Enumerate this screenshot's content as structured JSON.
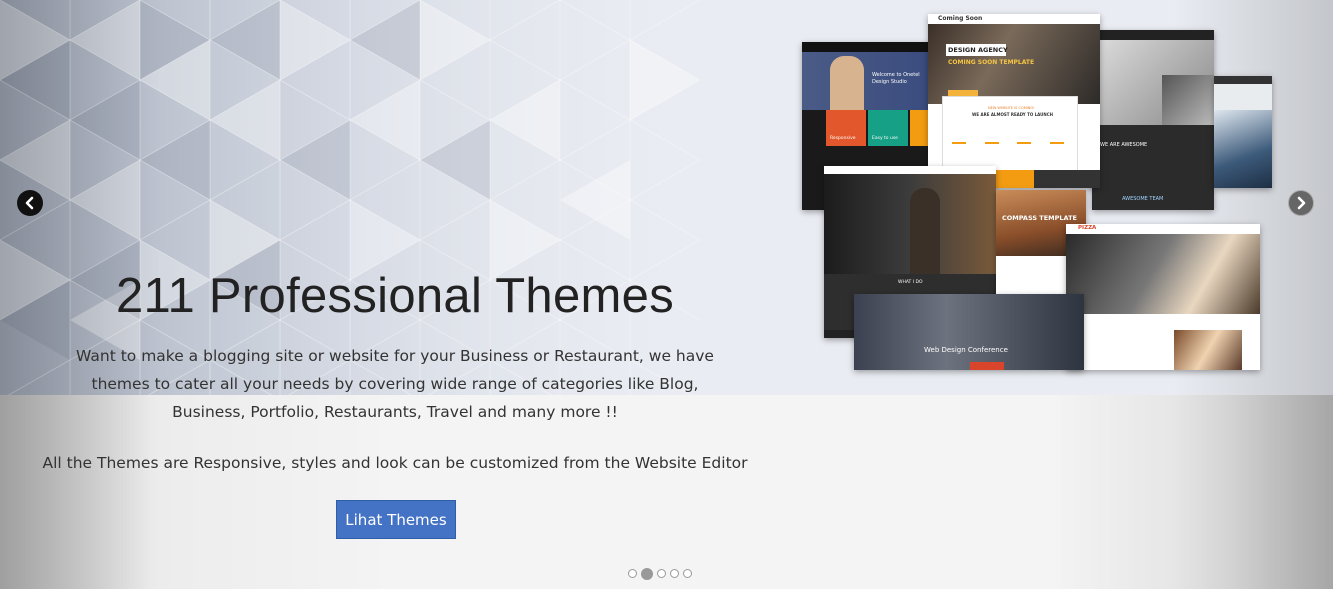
{
  "slide": {
    "title": "211 Professional Themes",
    "description": "Want to make a blogging site or website for your Business or Restaurant, we have themes to cater all your needs by covering wide range of categories like Blog, Business, Portfolio, Restaurants, Travel and many more !!",
    "description2": "All the Themes are Responsive, styles and look can be customized from the Website Editor",
    "cta_label": "Lihat Themes"
  },
  "navigation": {
    "prev_icon": "chevron-left-icon",
    "next_icon": "chevron-right-icon"
  },
  "pagination": {
    "count": 5,
    "active_index": 1
  },
  "collage": {
    "coming_soon_label": "Coming Soon",
    "design_agency_label": "DESIGN AGENCY",
    "coming_soon_template_label": "COMING SOON TEMPLATE",
    "website_coming_label": "NEW WEBSITE IS COMING!",
    "almost_ready_label": "WE ARE ALMOST READY TO LAUNCH",
    "welcome_label": "Welcome to Onetel Design Studio",
    "responsive_label": "Responsive",
    "easy_label": "Easy to use",
    "compass_label": "COMPASS TEMPLATE",
    "pizza_label": "PIZZA",
    "conference_label": "Web Design Conference",
    "awesome_label": "WE ARE AWESOME",
    "awesome_team_label": "AWESOME TEAM",
    "what_i_do_label": "WHAT I DO"
  },
  "colors": {
    "cta": "#4472c4",
    "orange": "#f39c12",
    "accent_red": "#d9452b",
    "teal": "#16a085"
  }
}
